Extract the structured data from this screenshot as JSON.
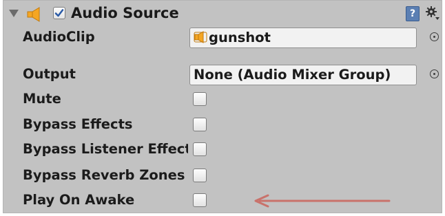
{
  "component": {
    "title": "Audio Source",
    "enabled": true,
    "icons": [
      "foldout-triangle-icon",
      "speaker-icon",
      "help-book-icon",
      "gear-icon"
    ]
  },
  "properties": {
    "audio_clip": {
      "label": "AudioClip",
      "value": "gunshot"
    },
    "output": {
      "label": "Output",
      "value": "None (Audio Mixer Group)"
    },
    "mute": {
      "label": "Mute",
      "checked": false
    },
    "bypass_effects": {
      "label": "Bypass Effects",
      "checked": false
    },
    "bypass_listener_effects": {
      "label": "Bypass Listener Effects",
      "checked": false
    },
    "bypass_reverb_zones": {
      "label": "Bypass Reverb Zones",
      "checked": false
    },
    "play_on_awake": {
      "label": "Play On Awake",
      "checked": false
    }
  },
  "annotation": {
    "arrow_color": "#c9726b",
    "points_to": "play_on_awake"
  },
  "colors": {
    "panel_bg": "#c2c2c2",
    "field_bg": "#f2f2f2",
    "speaker": "#f5a623"
  }
}
